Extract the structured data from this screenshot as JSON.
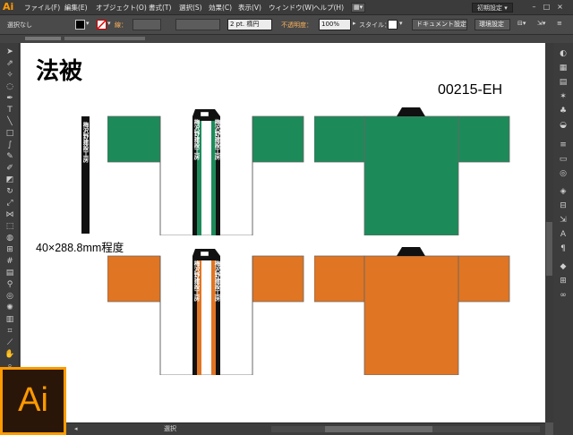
{
  "app": {
    "logo": "Ai",
    "workspace": "初期設定 ▾"
  },
  "menu": [
    "ファイル(F)",
    "編集(E)",
    "オブジェクト(O)",
    "書式(T)",
    "選択(S)",
    "効果(C)",
    "表示(V)",
    "ウィンドウ(W)",
    "ヘルプ(H)"
  ],
  "control": {
    "selection": "選択なし",
    "stroke_label": "線：",
    "stroke_value": "2 pt. 楕円",
    "opacity_label": "不透明度：",
    "opacity_value": "100%",
    "style_label": "スタイル：",
    "document_settings": "ドキュメント設定",
    "preferences": "環境設定"
  },
  "artboard": {
    "title": "法被",
    "product_code": "00215-EH",
    "dimension_note": "40×288.8mm程度",
    "collar_text": "梅沢野建設工房",
    "colors": {
      "green": "#1d8a5a",
      "orange": "#e07523",
      "black": "#111111"
    }
  },
  "statusbar": {
    "mode": "選択"
  },
  "badge": {
    "label": "Ai"
  }
}
